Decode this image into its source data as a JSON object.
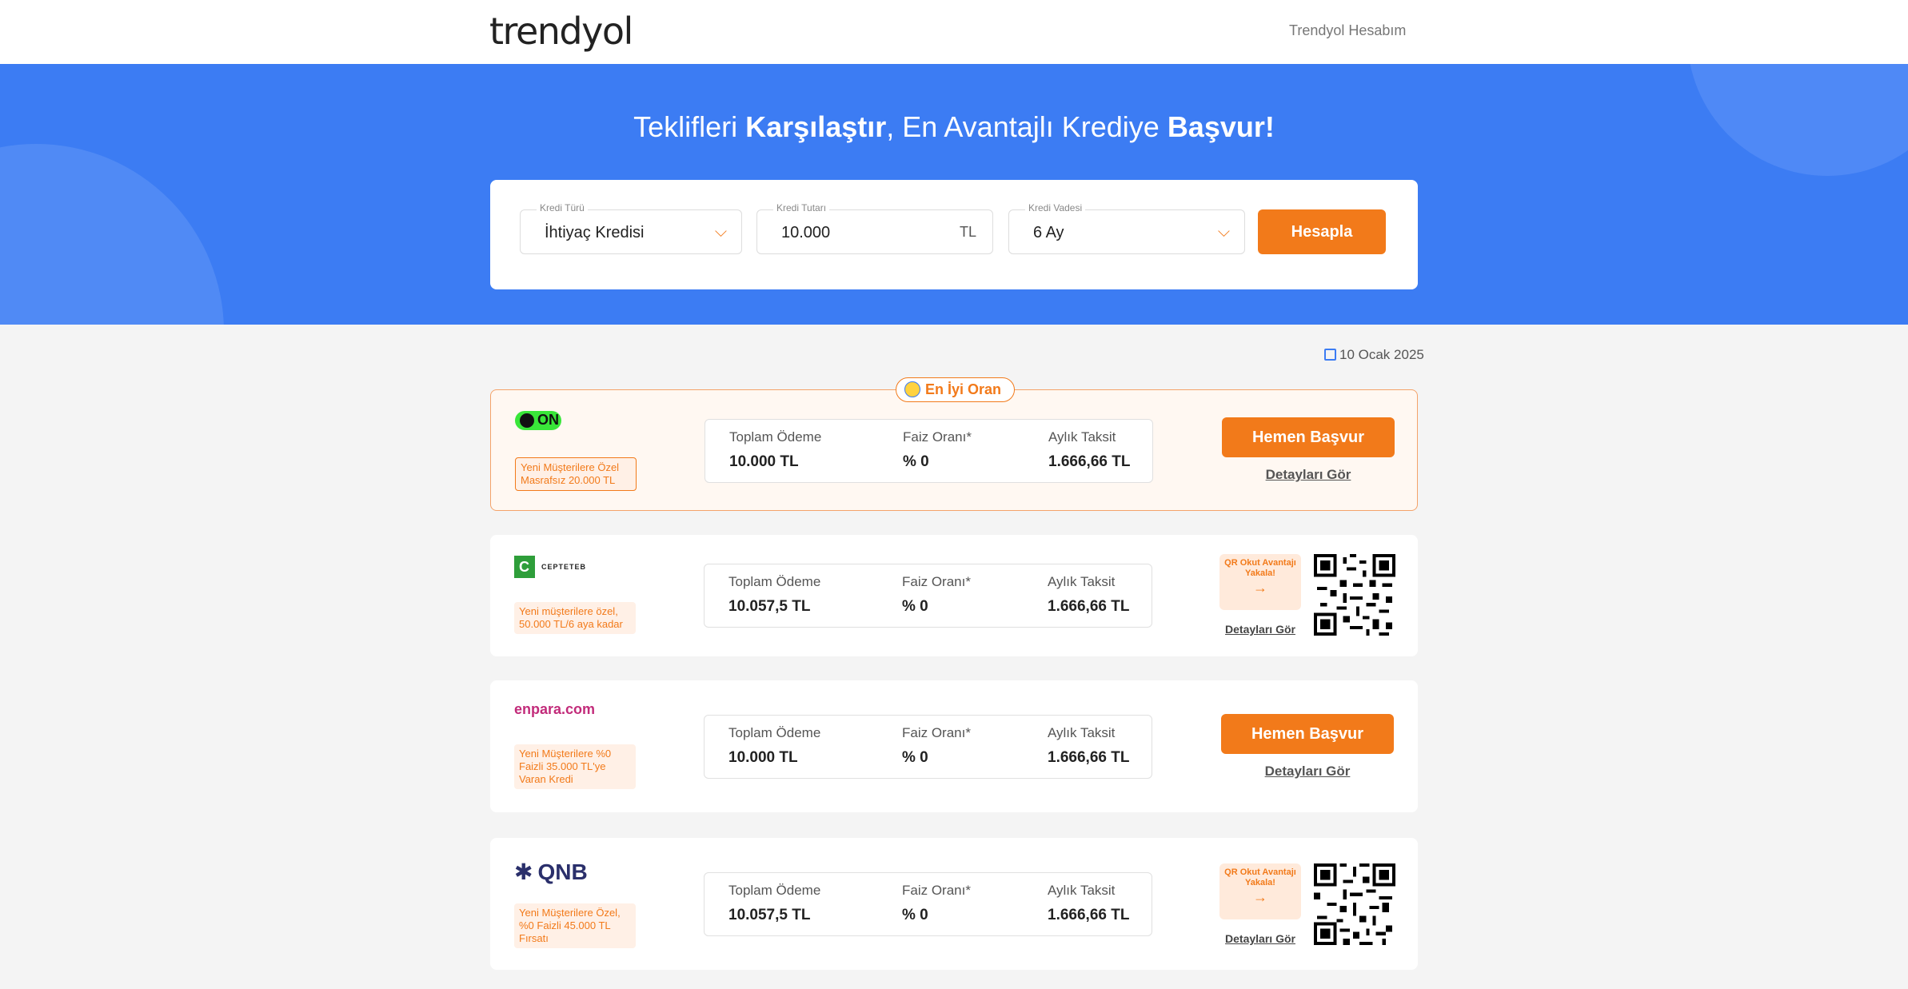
{
  "header": {
    "logo": "trendyol",
    "account": "Trendyol Hesabım"
  },
  "hero": {
    "title_1": "Teklifleri ",
    "title_2": "Karşılaştır",
    "title_3": ", En Avantajlı Krediye ",
    "title_4": "Başvur!"
  },
  "calculator": {
    "type_label": "Kredi Türü",
    "type_value": "İhtiyaç Kredisi",
    "amount_label": "Kredi Tutarı",
    "amount_value": "10.000",
    "amount_unit": "TL",
    "term_label": "Kredi Vadesi",
    "term_value": "6 Ay",
    "button": "Hesapla"
  },
  "date": "10 Ocak 2025",
  "offers": [
    {
      "bank": "ON",
      "best_badge": "En İyi Oran",
      "promo": "Yeni Müşterilere Özel Masrafsız 20.000 TL",
      "total_label": "Toplam Ödeme",
      "total": "10.000 TL",
      "rate_label": "Faiz Oranı*",
      "rate": "% 0",
      "monthly_label": "Aylık Taksit",
      "monthly": "1.666,66 TL",
      "apply": "Hemen Başvur",
      "details": "Detayları Gör"
    },
    {
      "bank": "CEPTETEB",
      "promo": "Yeni müşterilere özel, 50.000 TL/6 aya kadar",
      "total_label": "Toplam Ödeme",
      "total": "10.057,5 TL",
      "rate_label": "Faiz Oranı*",
      "rate": "% 0",
      "monthly_label": "Aylık Taksit",
      "monthly": "1.666,66 TL",
      "qr_text": "QR Okut Avantajı Yakala!",
      "details": "Detayları Gör"
    },
    {
      "bank": "enpara.com",
      "promo": "Yeni Müşterilere %0 Faizli 35.000 TL'ye Varan Kredi",
      "total_label": "Toplam Ödeme",
      "total": "10.000 TL",
      "rate_label": "Faiz Oranı*",
      "rate": "% 0",
      "monthly_label": "Aylık Taksit",
      "monthly": "1.666,66 TL",
      "apply": "Hemen Başvur",
      "details": "Detayları Gör"
    },
    {
      "bank": "QNB",
      "promo": "Yeni Müşterilere Özel, %0 Faizli 45.000 TL Fırsatı",
      "total_label": "Toplam Ödeme",
      "total": "10.057,5 TL",
      "rate_label": "Faiz Oranı*",
      "rate": "% 0",
      "monthly_label": "Aylık Taksit",
      "monthly": "1.666,66 TL",
      "qr_text": "QR Okut Avantajı Yakala!",
      "details": "Detayları Gör"
    }
  ],
  "colors": {
    "brand": "#f27a1a",
    "hero": "#3c7cf3"
  }
}
